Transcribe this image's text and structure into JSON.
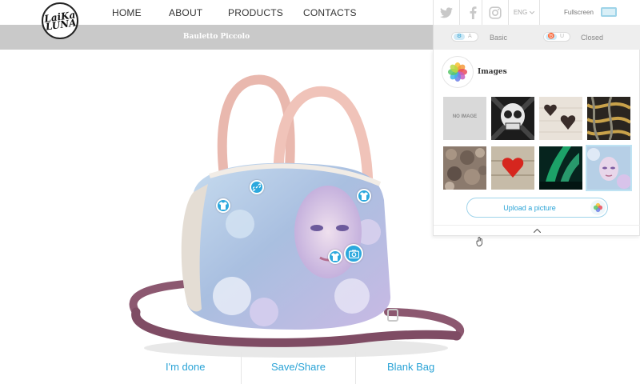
{
  "brand": {
    "logo_text": "LaiKa\nLUNA"
  },
  "nav": {
    "items": [
      "HOME",
      "ABOUT",
      "PRODUCTS",
      "CONTACTS"
    ]
  },
  "social": {
    "icons": [
      "twitter-icon",
      "facebook-icon",
      "instagram-icon"
    ]
  },
  "language": {
    "selected": "ENG"
  },
  "fullscreen": {
    "label": "Fullscreen"
  },
  "product": {
    "title": "Bauletto Piccolo"
  },
  "toggles": {
    "mode_label": "Basic",
    "state_label": "Closed"
  },
  "images_panel": {
    "title": "Images",
    "thumbnails": [
      {
        "name": "no-image",
        "label": "NO IMAGE"
      },
      {
        "name": "sugar-skull"
      },
      {
        "name": "hearts-on-wood"
      },
      {
        "name": "abstract-painting"
      },
      {
        "name": "stone-texture"
      },
      {
        "name": "red-heart"
      },
      {
        "name": "aurora"
      },
      {
        "name": "woman-portrait",
        "selected": true
      }
    ],
    "upload_label": "Upload a picture"
  },
  "actions": {
    "done": "I'm done",
    "save_share": "Save/Share",
    "blank_bag": "Blank Bag"
  },
  "colors": {
    "accent": "#2aa3d6",
    "handle": "#e9b8ae",
    "strap": "#8c5870"
  }
}
